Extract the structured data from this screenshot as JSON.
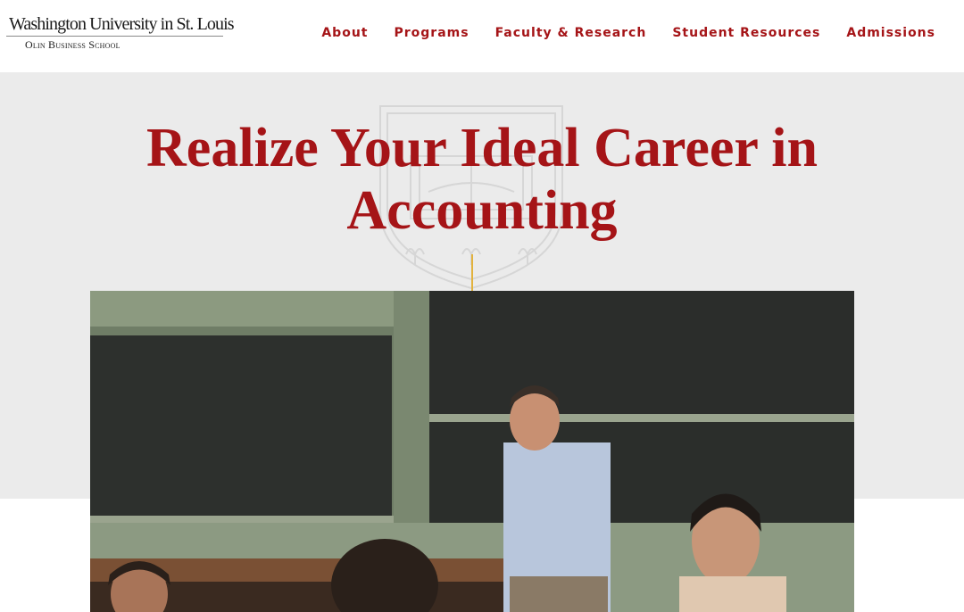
{
  "header": {
    "logo": {
      "university_name": "Washington University in St. Louis",
      "school_name": "Olin Business School",
      "shield_icon": "university-shield-icon"
    },
    "nav": [
      {
        "label": "About"
      },
      {
        "label": "Programs"
      },
      {
        "label": "Faculty & Research"
      },
      {
        "label": "Student Resources"
      },
      {
        "label": "Admissions"
      }
    ]
  },
  "hero": {
    "title": "Realize Your Ideal Career in Accounting",
    "crest_icon": "university-crest-watermark",
    "photo_icon": "classroom-photo"
  },
  "colors": {
    "brand_red": "#a51417",
    "accent_gold": "#e2b23d",
    "hero_bg": "#ebebeb"
  }
}
